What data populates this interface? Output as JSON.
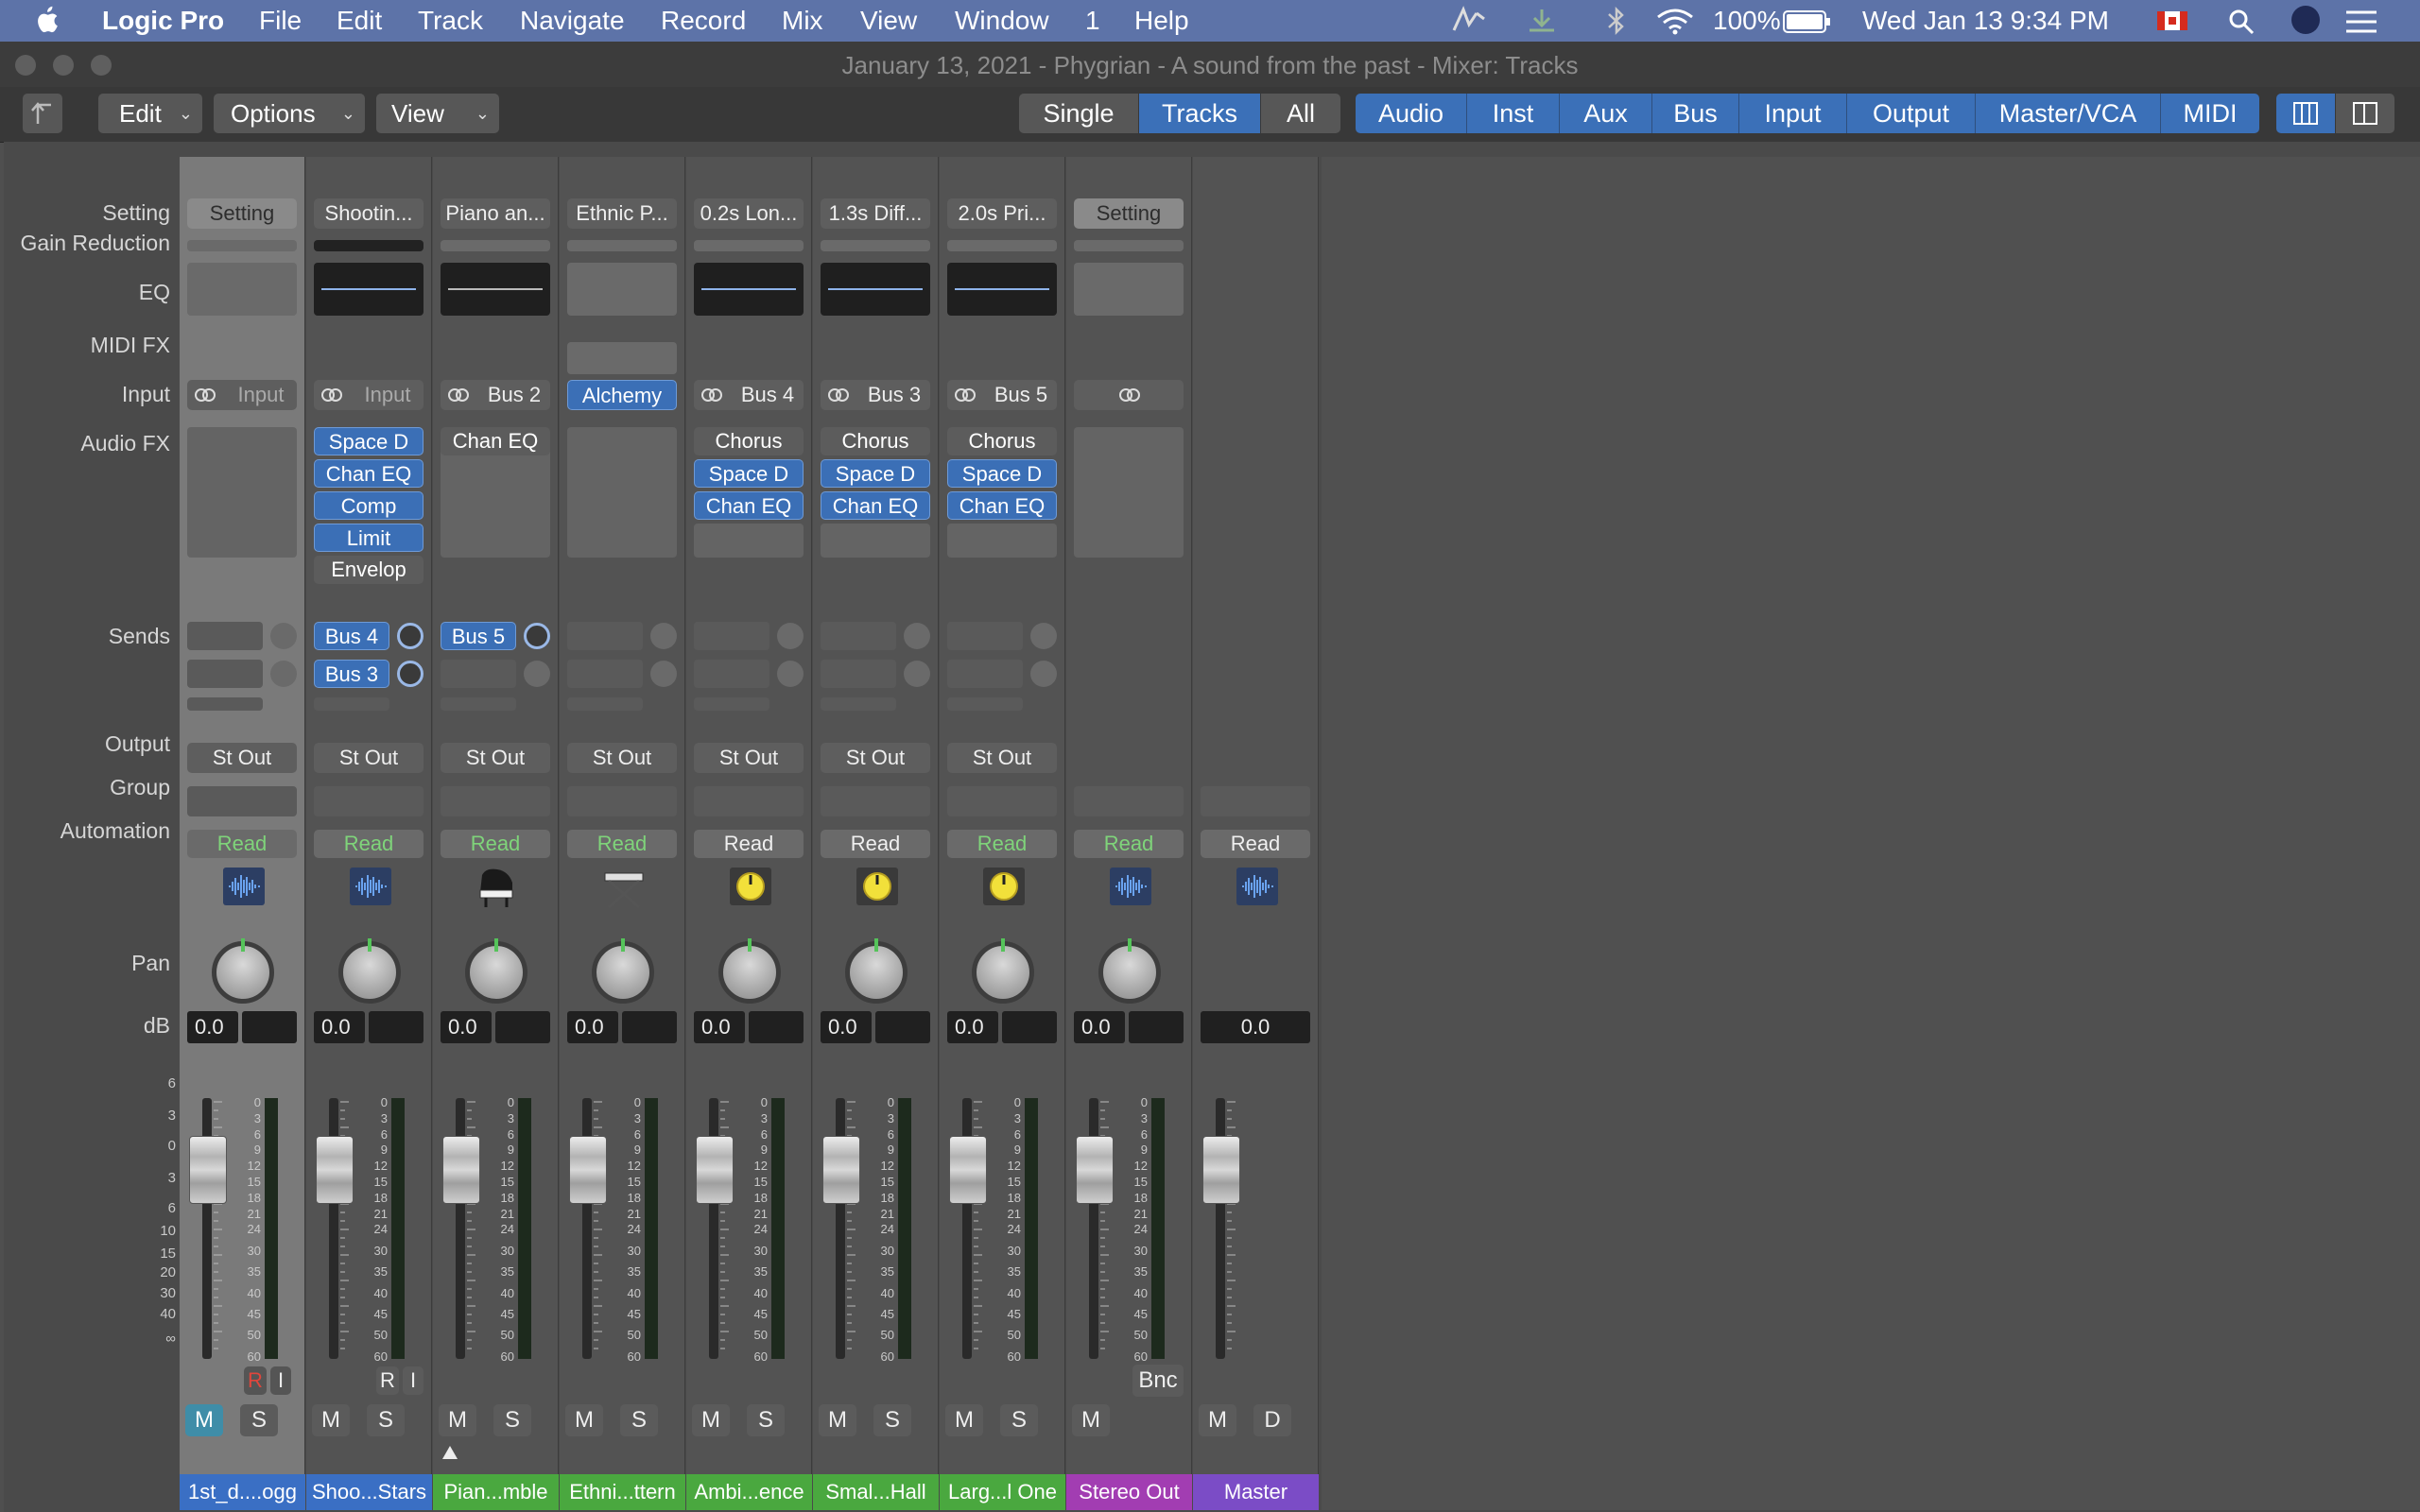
{
  "menubar": {
    "app": "Logic Pro",
    "items": [
      "File",
      "Edit",
      "Track",
      "Navigate",
      "Record",
      "Mix",
      "View",
      "Window",
      "1",
      "Help"
    ],
    "battery": "100%",
    "clock": "Wed Jan 13  9:34 PM"
  },
  "window": {
    "title": "January 13, 2021 - Phygrian - A sound from the past - Mixer: Tracks"
  },
  "toolbar": {
    "edit": "Edit",
    "options": "Options",
    "view": "View",
    "modes": [
      "Single",
      "Tracks",
      "All"
    ],
    "active_mode": "Tracks",
    "filters": [
      "Audio",
      "Inst",
      "Aux",
      "Bus",
      "Input",
      "Output",
      "Master/VCA",
      "MIDI"
    ]
  },
  "row_labels": {
    "setting": "Setting",
    "gain_reduction": "Gain Reduction",
    "eq": "EQ",
    "midi_fx": "MIDI FX",
    "input": "Input",
    "audio_fx": "Audio FX",
    "sends": "Sends",
    "output": "Output",
    "group": "Group",
    "automation": "Automation",
    "pan": "Pan",
    "db": "dB"
  },
  "left_scale": [
    "6",
    "3",
    "0",
    "3",
    "6",
    "10",
    "15",
    "20",
    "30",
    "40",
    "∞"
  ],
  "meter_scale": [
    "0",
    "3",
    "6",
    "9",
    "12",
    "15",
    "18",
    "21",
    "24",
    "30",
    "35",
    "40",
    "45",
    "50",
    "60"
  ],
  "strips": [
    {
      "setting": "Setting",
      "input": "Input",
      "audio_fx": [],
      "sends": [],
      "output": "St Out",
      "automation": "Read",
      "icon": "waveform-icon",
      "vol": "0.0",
      "rec": "R",
      "inmon": "I",
      "mute": "M",
      "solo": "S",
      "name": "1st_d....ogg",
      "color": "#3a6fc4",
      "selected": true,
      "eq": "empty",
      "mute_on": true
    },
    {
      "setting": "Shootin...",
      "input": "Input",
      "audio_fx": [
        "Space D",
        "Chan EQ",
        "Comp",
        "Limit",
        "Envelop"
      ],
      "sends": [
        "Bus 4",
        "Bus 3"
      ],
      "output": "St Out",
      "automation": "Read",
      "icon": "waveform-icon",
      "vol": "0.0",
      "rec": "R",
      "inmon": "I",
      "mute": "M",
      "solo": "S",
      "name": "Shoo...Stars",
      "color": "#3a6fc4",
      "eq": "line"
    },
    {
      "setting": "Piano an...",
      "input": "Bus 2",
      "audio_fx": [
        "Chan EQ"
      ],
      "sends": [
        "Bus 5"
      ],
      "output": "St Out",
      "automation": "Read",
      "icon": "piano-icon",
      "vol": "0.0",
      "mute": "M",
      "solo": "S",
      "name": "Pian...mble",
      "color": "#4aa83f",
      "eq": "flat"
    },
    {
      "setting": "Ethnic P...",
      "input": "Alchemy",
      "audio_fx": [],
      "sends": [],
      "output": "St Out",
      "automation": "Read",
      "icon": "keyboard-stand-icon",
      "vol": "0.0",
      "mute": "M",
      "solo": "S",
      "name": "Ethni...ttern",
      "color": "#4aa83f",
      "eq": "empty"
    },
    {
      "setting": "0.2s Lon...",
      "input": "Bus 4",
      "audio_fx": [
        "Chorus",
        "Space D",
        "Chan EQ"
      ],
      "sends": [],
      "output": "St Out",
      "automation": "Read",
      "icon": "aux-knob-icon",
      "vol": "0.0",
      "mute": "M",
      "solo": "S",
      "name": "Ambi...ence",
      "color": "#4aa83f",
      "eq": "line"
    },
    {
      "setting": "1.3s Diff...",
      "input": "Bus 3",
      "audio_fx": [
        "Chorus",
        "Space D",
        "Chan EQ"
      ],
      "sends": [],
      "output": "St Out",
      "automation": "Read",
      "icon": "aux-knob-icon",
      "vol": "0.0",
      "mute": "M",
      "solo": "S",
      "name": "Smal...Hall",
      "color": "#4aa83f",
      "eq": "line"
    },
    {
      "setting": "2.0s Pri...",
      "input": "Bus 5",
      "audio_fx": [
        "Chorus",
        "Space D",
        "Chan EQ"
      ],
      "sends": [],
      "output": "St Out",
      "automation": "Read",
      "icon": "aux-knob-icon",
      "vol": "0.0",
      "mute": "M",
      "solo": "S",
      "name": "Larg...l One",
      "color": "#4aa83f",
      "eq": "line"
    },
    {
      "setting": "Setting",
      "input": "",
      "audio_fx": [],
      "sends": [],
      "output": "",
      "automation": "Read",
      "icon": "waveform-icon",
      "vol": "0.0",
      "bnc": "Bnc",
      "mute": "M",
      "name": "Stereo Out",
      "color": "#a23db2",
      "eq": "empty"
    },
    {
      "setting": "",
      "input": "",
      "audio_fx": [],
      "sends": [],
      "output": "",
      "automation": "Read",
      "icon": "waveform-icon",
      "vol": "0.0",
      "mute": "M",
      "dim": "D",
      "name": "Master",
      "color": "#7b4cc6",
      "eq": "none"
    }
  ],
  "colors": {
    "menubar": "#5d73a8",
    "selected_blue": "#3b70b8",
    "automation_green": "#7fd47a",
    "mute_on": "#3f8da8",
    "rec_red": "#e0463c"
  }
}
